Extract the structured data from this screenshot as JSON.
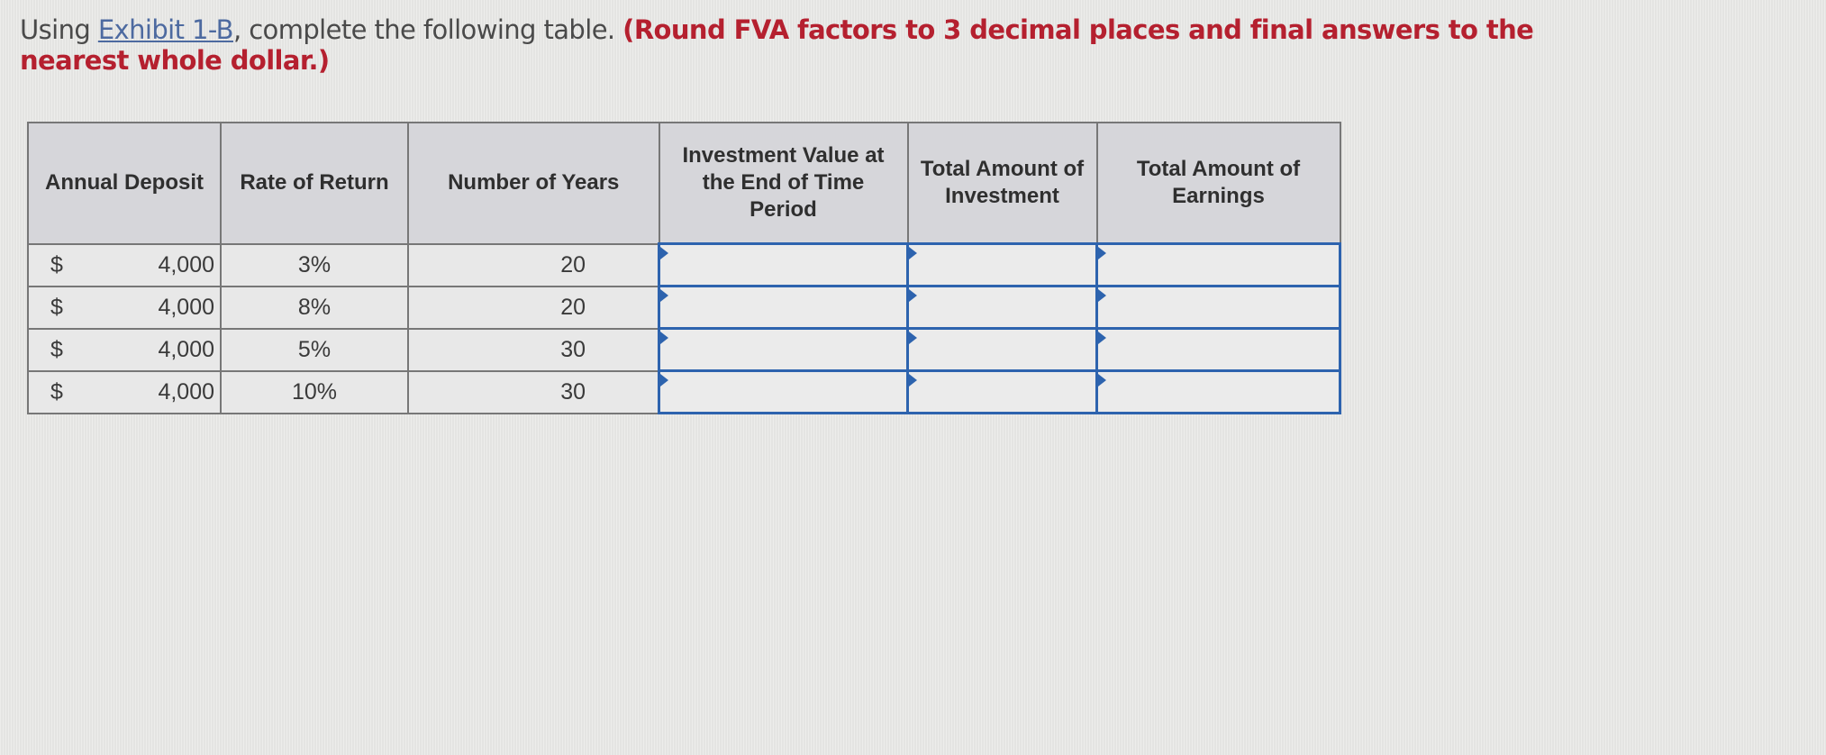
{
  "question": {
    "prefix": "Using ",
    "link_text": "Exhibit 1-B",
    "middle": ", complete the following table. ",
    "instruction": "(Round FVA factors to 3 decimal places and final answers to the nearest whole dollar.)"
  },
  "table": {
    "headers": {
      "annual_deposit": "Annual Deposit",
      "rate_of_return": "Rate of Return",
      "number_of_years": "Number of Years",
      "investment_value": "Investment Value at the End of Time Period",
      "total_investment": "Total Amount of Investment",
      "total_earnings": "Total Amount of Earnings"
    },
    "rows": [
      {
        "currency": "$",
        "deposit": "4,000",
        "rate": "3%",
        "years": "20",
        "investment_value": "",
        "total_investment": "",
        "total_earnings": ""
      },
      {
        "currency": "$",
        "deposit": "4,000",
        "rate": "8%",
        "years": "20",
        "investment_value": "",
        "total_investment": "",
        "total_earnings": ""
      },
      {
        "currency": "$",
        "deposit": "4,000",
        "rate": "5%",
        "years": "30",
        "investment_value": "",
        "total_investment": "",
        "total_earnings": ""
      },
      {
        "currency": "$",
        "deposit": "4,000",
        "rate": "10%",
        "years": "30",
        "investment_value": "",
        "total_investment": "",
        "total_earnings": ""
      }
    ]
  },
  "colors": {
    "instruction": "#b5202f",
    "link": "#4d6aa0",
    "input_border": "#2d63ae",
    "header_bg": "#d6d6da"
  }
}
